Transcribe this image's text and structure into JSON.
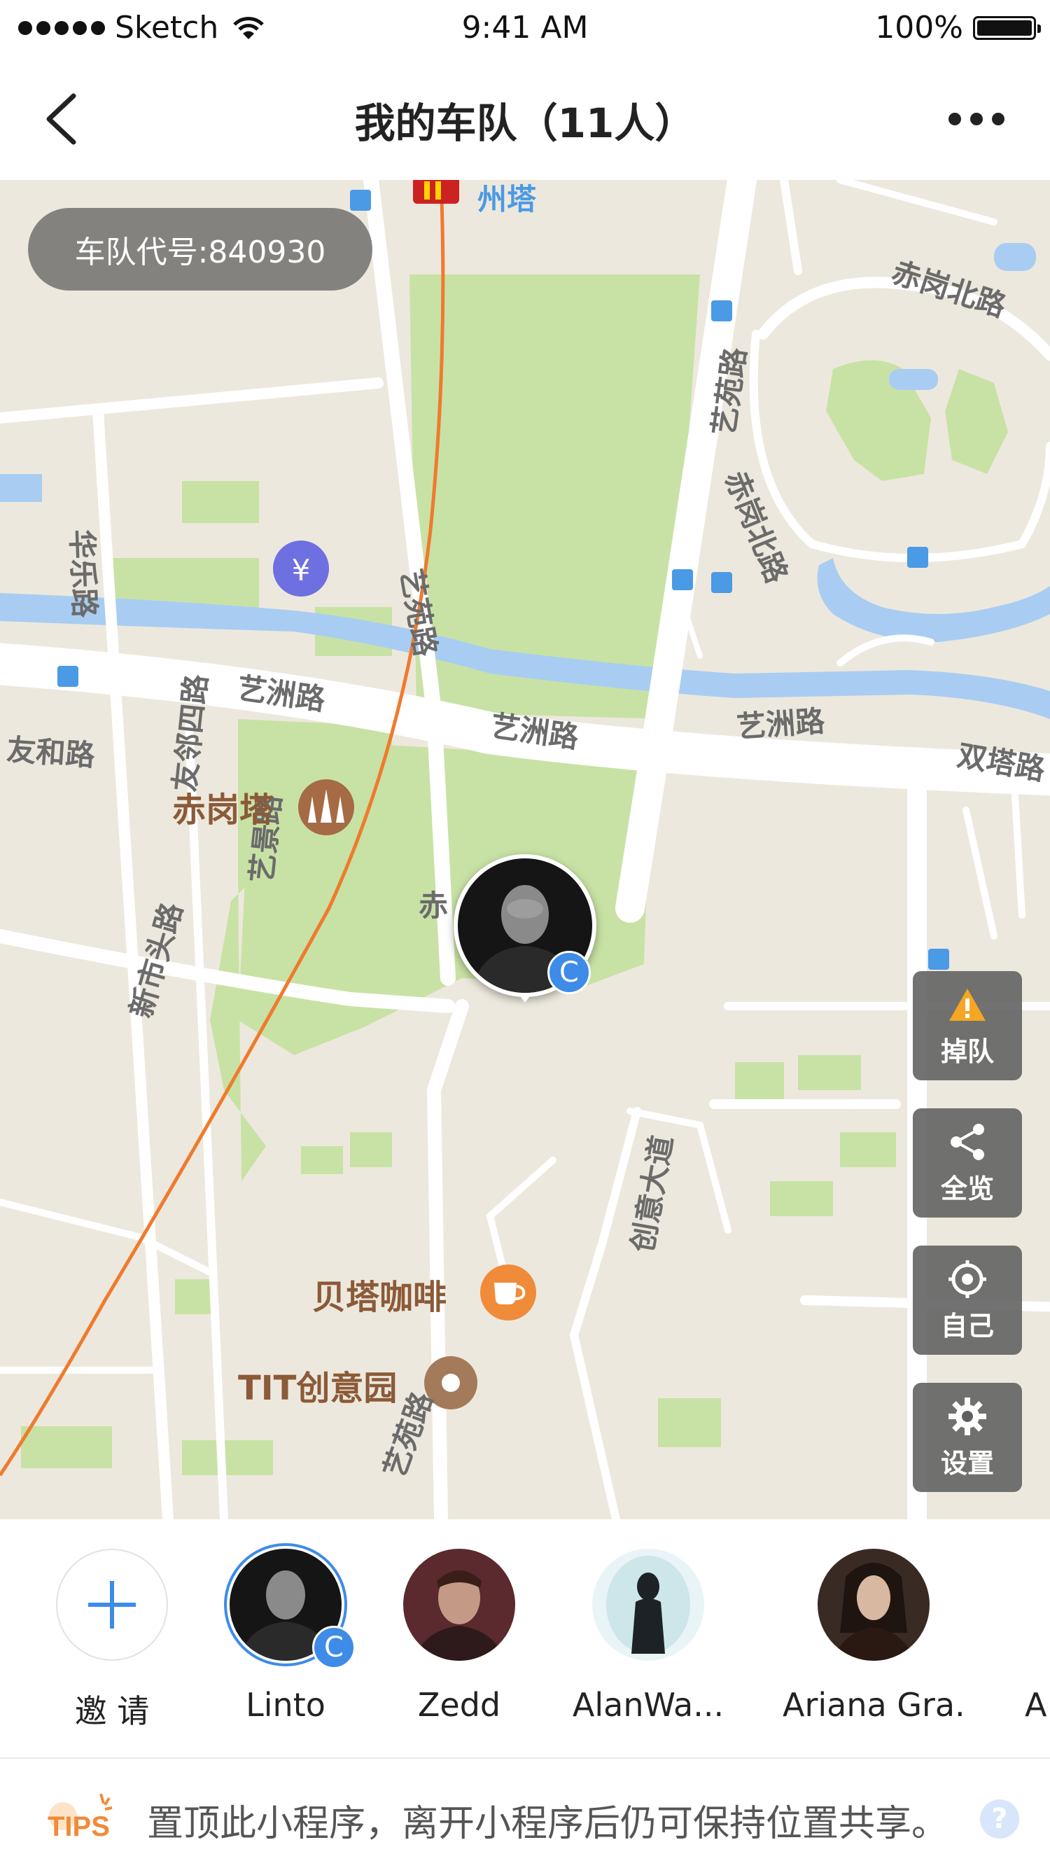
{
  "status_bar": {
    "carrier": "Sketch",
    "time": "9:41 AM",
    "battery": "100%",
    "icons": [
      "signal-dots-icon",
      "wifi-icon",
      "battery-icon"
    ]
  },
  "nav": {
    "title": "我的车队（11人）",
    "back_icon": "chevron-left-icon",
    "more_icon": "more-dots-icon"
  },
  "map": {
    "fleet_code": "车队代号:840930",
    "street_labels": [
      "州塔",
      "赤岗北路",
      "艺苑路",
      "赤岗北路",
      "华乐路",
      "艺苑路",
      "艺洲路",
      "艺洲路",
      "艺洲路",
      "双塔路",
      "友和路",
      "友邻四路",
      "艺景路",
      "赤",
      "新市头路",
      "创意大道",
      "艺苑路"
    ],
    "pois": [
      "赤岗塔",
      "贝塔咖啡",
      "TIT创意园"
    ],
    "route_color": "#f07a2e",
    "marker_badge": "C"
  },
  "side_buttons": [
    {
      "label": "掉队",
      "icon": "warning-icon"
    },
    {
      "label": "全览",
      "icon": "share-nodes-icon"
    },
    {
      "label": "自己",
      "icon": "locate-icon"
    },
    {
      "label": "设置",
      "icon": "gear-icon"
    }
  ],
  "members": {
    "invite_label": "邀 请",
    "list": [
      {
        "name": "Linto",
        "badge": "C",
        "selected": true
      },
      {
        "name": "Zedd"
      },
      {
        "name": "AlanWa..."
      },
      {
        "name": "Ariana Gra..."
      },
      {
        "name": "A"
      }
    ]
  },
  "tips": {
    "logo_text": "TIPS",
    "text": "置顶此小程序，离开小程序后仍可保持位置共享。",
    "help": "?"
  },
  "colors": {
    "accent": "#3e8be8",
    "tips_orange": "#f08b3a",
    "park_green": "#c8e2a5",
    "water_blue": "#a9cdf2"
  }
}
